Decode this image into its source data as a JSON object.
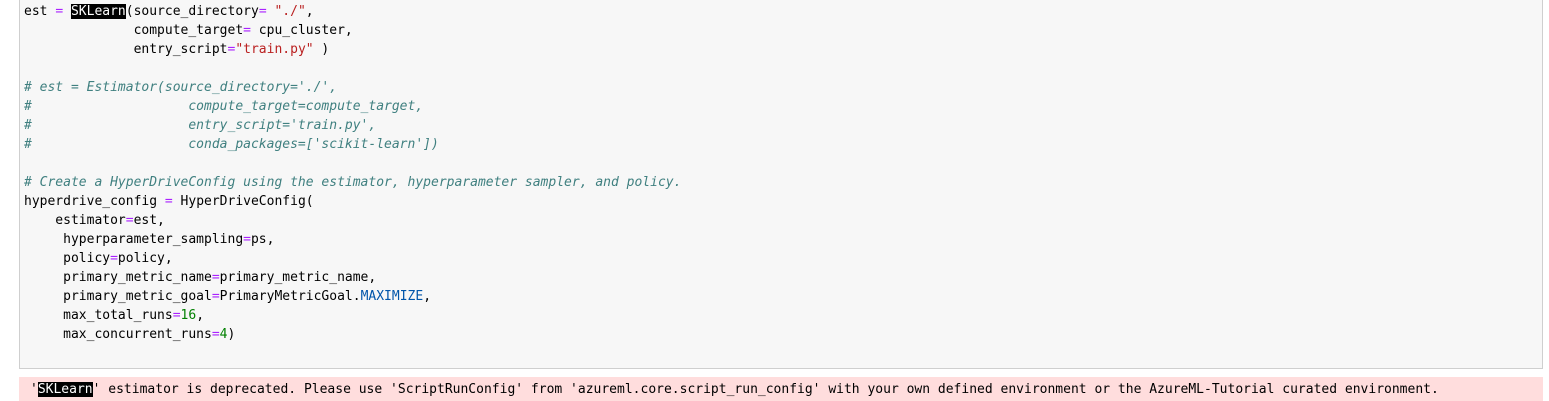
{
  "code": {
    "l1_a": "est",
    "l1_eq": "=",
    "l1_cls": "SKLearn",
    "l1_b": "(source_directory",
    "l1_eq2": "=",
    "l1_str": " \"./\"",
    "l1_c": ",",
    "l2_a": "              compute_target",
    "l2_eq": "=",
    "l2_b": " cpu_cluster,",
    "l3_a": "              entry_script",
    "l3_eq": "=",
    "l3_str": "\"train.py\"",
    "l3_b": " )",
    "l5": "# est = Estimator(source_directory='./',",
    "l6": "#                    compute_target=compute_target,",
    "l7": "#                    entry_script='train.py',",
    "l8": "#                    conda_packages=['scikit-learn'])",
    "l10": "# Create a HyperDriveConfig using the estimator, hyperparameter sampler, and policy.",
    "l11_a": "hyperdrive_config",
    "l11_eq": "=",
    "l11_b": " HyperDriveConfig(",
    "l12_a": "    estimator",
    "l12_eq": "=",
    "l12_b": "est,",
    "l13_a": "     hyperparameter_sampling",
    "l13_eq": "=",
    "l13_b": "ps,",
    "l14_a": "     policy",
    "l14_eq": "=",
    "l14_b": "policy,",
    "l15_a": "     primary_metric_name",
    "l15_eq": "=",
    "l15_b": "primary_metric_name,",
    "l16_a": "     primary_metric_goal",
    "l16_eq": "=",
    "l16_b": "PrimaryMetricGoal.",
    "l16_attr": "MAXIMIZE",
    "l16_c": ",",
    "l17_a": "     max_total_runs",
    "l17_eq": "=",
    "l17_num": "16",
    "l17_c": ",",
    "l18_a": "     max_concurrent_runs",
    "l18_eq": "=",
    "l18_num": "4",
    "l18_c": ")"
  },
  "warning": {
    "quote_open": "'",
    "cls": "SKLearn",
    "text": "' estimator is deprecated. Please use 'ScriptRunConfig' from 'azureml.core.script_run_config' with your own defined environment or the AzureML-Tutorial curated environment."
  },
  "colors": {
    "cell_bg": "#f7f7f7",
    "warning_bg": "#ffdddd",
    "string": "#ba2121",
    "comment": "#408080",
    "operator": "#aa22ff",
    "number": "#008000"
  }
}
